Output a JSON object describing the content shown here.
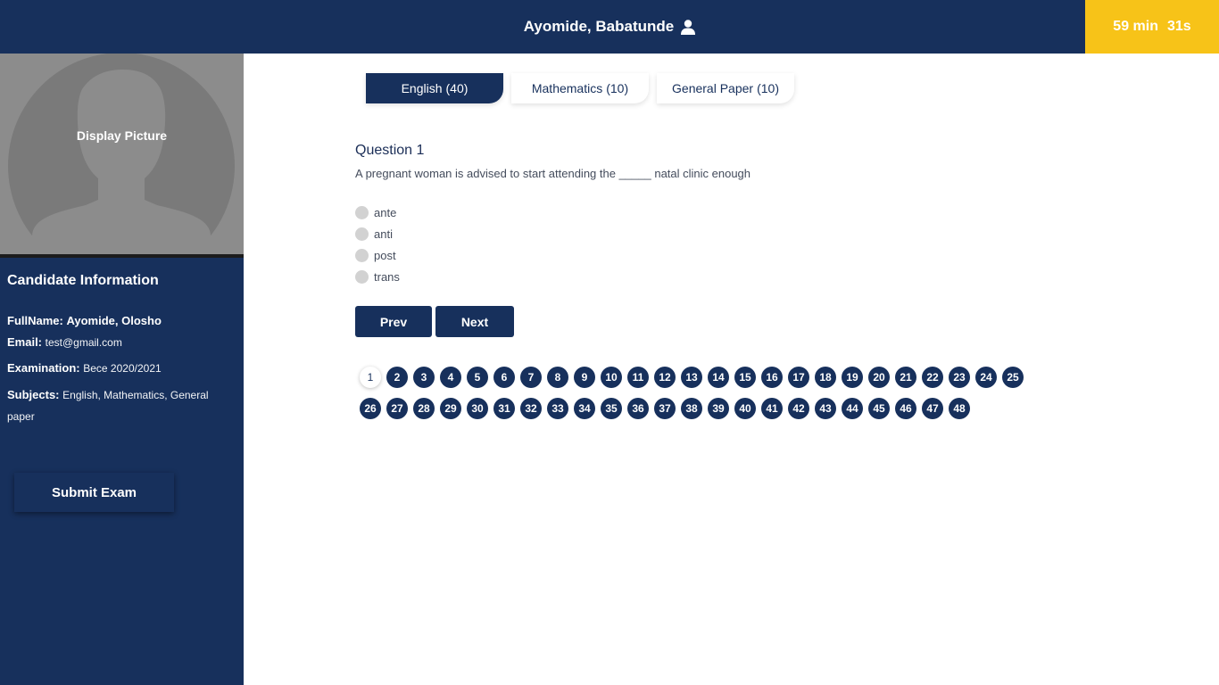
{
  "header": {
    "user_name": "Ayomide, Babatunde",
    "user_icon": "user-icon",
    "timer": {
      "minutes": "59 min",
      "seconds": "31s"
    }
  },
  "sidebar": {
    "photo_label": "Display Picture",
    "info_title": "Candidate Information",
    "info": [
      {
        "label": "FullName:",
        "value": "Ayomide, Olosho"
      },
      {
        "label": "Email:",
        "value": "test@gmail.com"
      },
      {
        "label": "Examination:",
        "value": "Bece 2020/2021"
      },
      {
        "label": "Subjects:",
        "value": "English, Mathematics, General paper"
      }
    ],
    "submit_label": "Submit Exam"
  },
  "tabs": [
    {
      "name": "English",
      "count": "(40)",
      "active": true
    },
    {
      "name": "Mathematics",
      "count": "(10)",
      "active": false
    },
    {
      "name": "General Paper",
      "count": "(10)",
      "active": false
    }
  ],
  "question": {
    "title": "Question 1",
    "text": "A pregnant woman is advised to start attending the _____ natal clinic enough",
    "options": [
      "ante",
      "anti",
      "post",
      "trans"
    ]
  },
  "nav": {
    "prev_label": "Prev",
    "next_label": "Next"
  },
  "question_numbers": [
    "1",
    "2",
    "3",
    "4",
    "5",
    "6",
    "7",
    "8",
    "9",
    "10",
    "11",
    "12",
    "13",
    "14",
    "15",
    "16",
    "17",
    "18",
    "19",
    "20",
    "21",
    "22",
    "23",
    "24",
    "25",
    "26",
    "27",
    "28",
    "29",
    "30",
    "31",
    "32",
    "33",
    "34",
    "35",
    "36",
    "37",
    "38",
    "39",
    "40",
    "41",
    "42",
    "43",
    "44",
    "45",
    "46",
    "47",
    "48"
  ],
  "current_question": "1",
  "colors": {
    "primary": "#17305c",
    "timer": "#f7c318"
  }
}
